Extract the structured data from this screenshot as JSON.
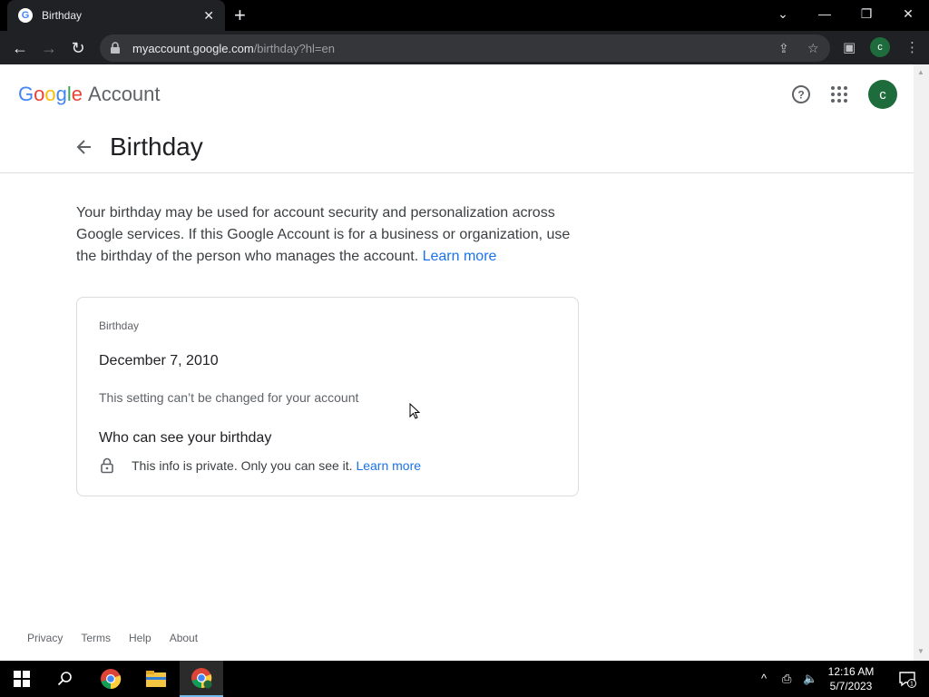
{
  "browser": {
    "tab_title": "Birthday",
    "url_host": "myaccount.google.com",
    "url_path": "/birthday?hl=en",
    "profile_initial": "c"
  },
  "header": {
    "logo_text": "Google",
    "account_label": "Account",
    "avatar_initial": "c"
  },
  "page": {
    "title": "Birthday",
    "description": "Your birthday may be used for account security and personalization across Google services. If this Google Account is for a business or organization, use the birthday of the person who manages the account.",
    "learn_more": "Learn more"
  },
  "card": {
    "label": "Birthday",
    "value": "December 7, 2010",
    "note": "This setting can’t be changed for your account",
    "who_heading": "Who can see your birthday",
    "privacy_text": "This info is private. Only you can see it.",
    "learn_more": "Learn more"
  },
  "footer": {
    "privacy": "Privacy",
    "terms": "Terms",
    "help": "Help",
    "about": "About"
  },
  "taskbar": {
    "time": "12:16 AM",
    "date": "5/7/2023",
    "notification_count": "1"
  },
  "colors": {
    "accent": "#1a73e8",
    "avatar": "#1e6b3c"
  }
}
